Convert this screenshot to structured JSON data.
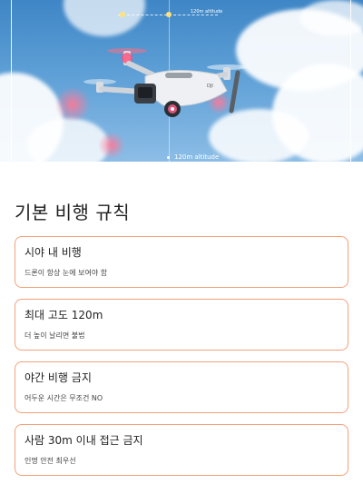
{
  "hero": {
    "hud_top_text": "120m altitude",
    "hud_bottom_text": "120m altitude",
    "drone_label": "DJI"
  },
  "section": {
    "title": "기본 비행 규칙"
  },
  "rules": [
    {
      "title": "시야 내 비행",
      "description": "드론이 항상 눈에 보여야 함"
    },
    {
      "title": "최대 고도 120m",
      "description": "더 높이 날리면 불법"
    },
    {
      "title": "야간 비행 금지",
      "description": "어두운 시간은 무조건 NO"
    },
    {
      "title": "사람 30m 이내 접근 금지",
      "description": "인명 안전 최우선"
    }
  ],
  "colors": {
    "card_border": "#f3a07a",
    "sky": "#5d9fd6"
  }
}
